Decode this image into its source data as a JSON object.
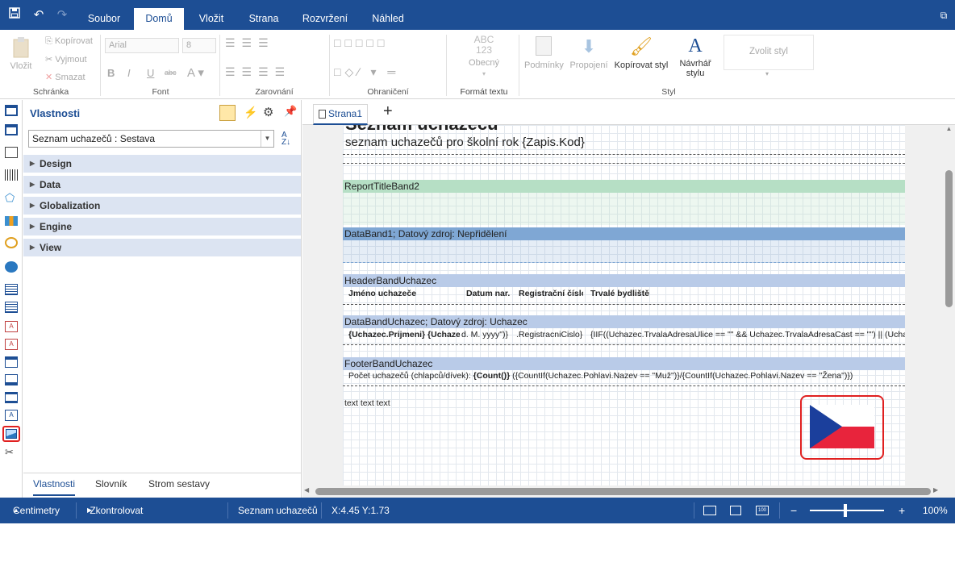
{
  "titlebar": {
    "tabs": [
      "Soubor",
      "Domů",
      "Vložit",
      "Strana",
      "Rozvržení",
      "Náhled"
    ],
    "active_tab": "Domů"
  },
  "ribbon": {
    "clipboard": {
      "paste": "Vložit",
      "copy": "Kopírovat",
      "cut": "Vyjmout",
      "delete": "Smazat",
      "label": "Schránka"
    },
    "font": {
      "family": "Arial",
      "size": "8",
      "label": "Font"
    },
    "alignment": {
      "label": "Zarovnání"
    },
    "borders": {
      "label": "Ohraničení"
    },
    "text_format": {
      "preview": "ABC\n123",
      "value": "Obecný",
      "label": "Formát textu"
    },
    "style": {
      "conditions": "Podmínky",
      "links": "Propojení",
      "copy_style": "Kopírovat styl",
      "designer": "Návrhář stylu",
      "choose": "Zvolit styl",
      "label": "Styl"
    }
  },
  "properties_panel": {
    "title": "Vlastnosti",
    "selected": "Seznam uchazečů : Sestava",
    "categories": [
      "Design",
      "Data",
      "Globalization",
      "Engine",
      "View"
    ],
    "tabs": [
      "Vlastnosti",
      "Slovník",
      "Strom sestavy"
    ],
    "active_tab": "Vlastnosti"
  },
  "document": {
    "tab": "Strana1",
    "title_partial": "Seznam uchazečů",
    "subtitle": "seznam uchazečů pro školní rok {Zapis.Kod}",
    "bands": {
      "report_title": "ReportTitleBand2",
      "data1": "DataBand1; Datový zdroj: Nepřidělení",
      "header": "HeaderBandUchazec",
      "data_uchazec": "DataBandUchazec; Datový zdroj: Uchazec",
      "footer": "FooterBandUchazec"
    },
    "header_cells": [
      "Jméno uchazeče",
      "Datum nar.",
      "Registrační číslo",
      "Trvalé bydliště"
    ],
    "data_cells": [
      "{Uchazec.Prijmeni} {Uchazec.",
      "d. M. yyyy\")}",
      ".RegistracniCislo}",
      "{IIF((Uchazec.TrvalaAdresaUlice == \"\" && Uchazec.TrvalaAdresaCast == \"\") || (Uchaze"
    ],
    "footer_text_plain": "Počet uchazečů (chlapců/dívek): ",
    "footer_text_bold": "{Count()}",
    "footer_text_tail": " ({CountIf(Uchazec.Pohlavi.Nazev == \"Muž\")}/{CountIf(Uchazec.Pohlavi.Nazev == \"Žena\")})",
    "free_text": "text text text"
  },
  "statusbar": {
    "units": "Centimetry",
    "check": "Zkontrolovat problémová místa",
    "report": "Seznam uchazečů",
    "coords": "X:4.45 Y:1.73",
    "zoom": "100%"
  },
  "colors": {
    "brand": "#1d4e94",
    "report_title_band": "#b6dfc5",
    "data_band": "#7fa7d4",
    "header_band": "#b9cbe8",
    "highlight": "#e02020"
  }
}
